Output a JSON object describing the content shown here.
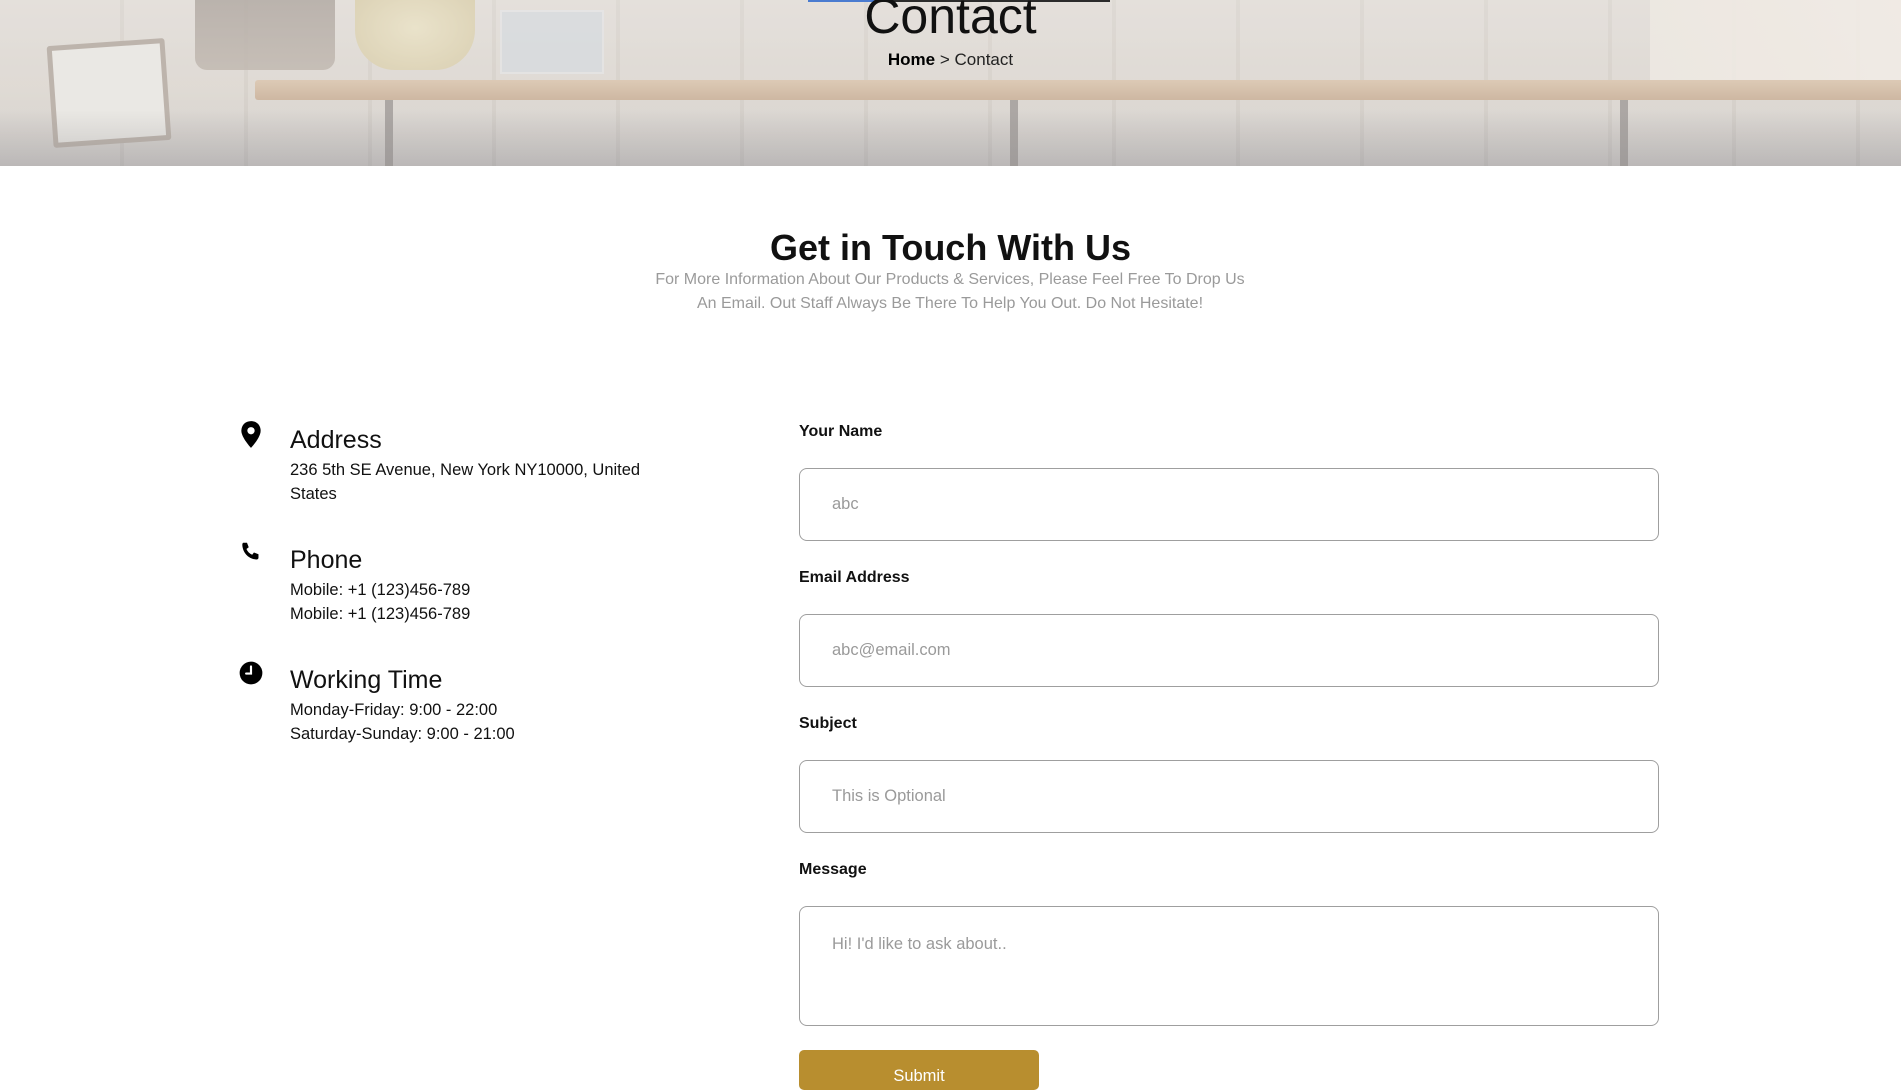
{
  "page_header": {
    "title": "Contact",
    "breadcrumb": {
      "home": "Home",
      "separator": ">",
      "current": "Contact"
    }
  },
  "intro": {
    "heading": "Get in Touch With Us",
    "description_line1": "For More Information About Our Products & Services, Please Feel Free To Drop Us",
    "description_line2": "An Email. Out Staff Always Be There To Help You Out. Do Not Hesitate!"
  },
  "contact_info": {
    "address": {
      "icon": "location-pin-icon",
      "title": "Address",
      "line1": "236 5th SE Avenue, New York NY10000, United States"
    },
    "phone": {
      "icon": "phone-icon",
      "title": "Phone",
      "line1": "Mobile: +1 (123)456-789",
      "line2": "Mobile: +1 (123)456-789"
    },
    "working_time": {
      "icon": "clock-icon",
      "title": "Working Time",
      "line1": "Monday-Friday: 9:00 - 22:00",
      "line2": "Saturday-Sunday: 9:00 - 21:00"
    }
  },
  "form": {
    "name_label": "Your Name",
    "name_placeholder": "abc",
    "email_label": "Email Address",
    "email_placeholder": "abc@email.com",
    "subject_label": "Subject",
    "subject_placeholder": "This is Optional",
    "message_label": "Message",
    "message_placeholder": "Hi! I'd like to ask about..",
    "submit_label": "Submit"
  },
  "colors": {
    "accent": "#B88E2F",
    "muted_text": "#9A9A9A",
    "border": "#9F9F9F"
  }
}
